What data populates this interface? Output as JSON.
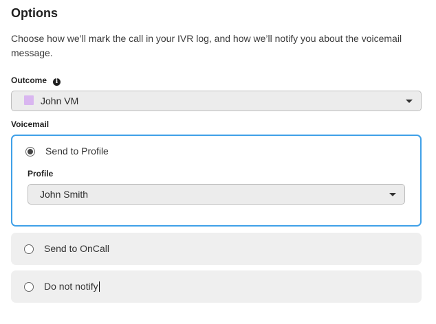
{
  "title": "Options",
  "description": "Choose how we’ll mark the call in your IVR log, and how we’ll notify you about the voicemail message.",
  "outcome": {
    "label": "Outcome",
    "info_icon": "i",
    "selected": "John VM",
    "swatch_color": "#d9b6f0"
  },
  "voicemail": {
    "label": "Voicemail",
    "options": [
      {
        "label": "Send to Profile",
        "selected": true
      },
      {
        "label": "Send to OnCall",
        "selected": false
      },
      {
        "label": "Do not notify",
        "selected": false
      }
    ],
    "profile": {
      "label": "Profile",
      "selected": "John Smith"
    }
  },
  "colors": {
    "accent": "#3fa0e8",
    "card_bg": "#efefef"
  }
}
